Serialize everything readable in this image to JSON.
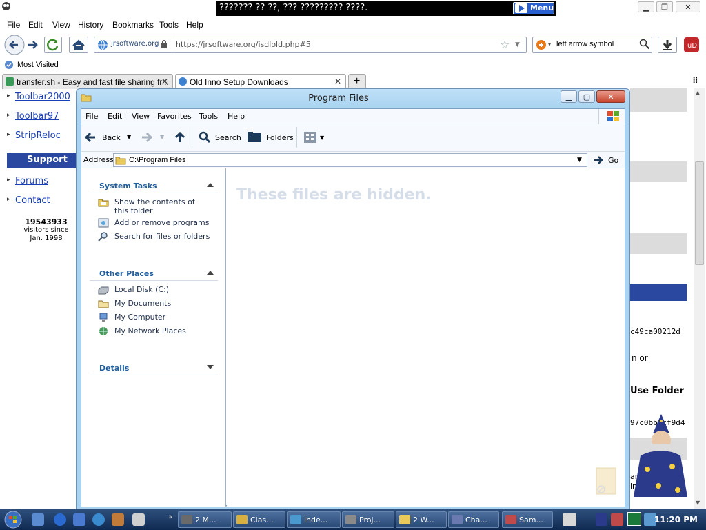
{
  "browser": {
    "banner_text": "??????? ?? ??, ??? ????????? ????.",
    "menu_label": "Menu",
    "menubar": [
      "File",
      "Edit",
      "View",
      "History",
      "Bookmarks",
      "Tools",
      "Help"
    ],
    "url_site_label": "jrsoftware.org",
    "url": "https://jrsoftware.org/isdlold.php#5",
    "search_value": "left arrow symbol",
    "bookmark": "Most Visited",
    "tabs": [
      {
        "label": "transfer.sh - Easy and fast file sharing fr..."
      },
      {
        "label": "Old Inno Setup Downloads"
      }
    ],
    "new_tab_label": "+"
  },
  "page": {
    "sidebar_links": [
      "Toolbar2000",
      "Toolbar97",
      "StripReloc"
    ],
    "support_heading": "Support",
    "support_links": [
      "Forums",
      "Contact"
    ],
    "visitor_count": "19543933",
    "visitor_line1": "visitors since",
    "visitor_line2": "Jan. 1998",
    "right_fragments": [
      "c49ca00212d",
      "n or",
      "Use Folder",
      "97c0bb cf9d4",
      "an",
      "ins"
    ]
  },
  "explorer": {
    "title": "Program Files",
    "menu": [
      "File",
      "Edit",
      "View",
      "Favorites",
      "Tools",
      "Help"
    ],
    "toolbar": {
      "back": "Back",
      "search": "Search",
      "folders": "Folders"
    },
    "address_label": "Address",
    "address_value": "C:\\Program Files",
    "go_label": "Go",
    "system_tasks": {
      "heading": "System Tasks",
      "items": [
        "Show the contents of this folder",
        "Add or remove programs",
        "Search for files or folders"
      ]
    },
    "other_places": {
      "heading": "Other Places",
      "items": [
        "Local Disk (C:)",
        "My Documents",
        "My Computer",
        "My Network Places"
      ]
    },
    "details_heading": "Details",
    "hidden_message": "These files are hidden."
  },
  "taskbar": {
    "buttons": [
      "2 M...",
      "Clas...",
      "inde...",
      "Proj...",
      "2 W...",
      "Cha...",
      "Sam..."
    ],
    "clock": "11:20 PM"
  }
}
